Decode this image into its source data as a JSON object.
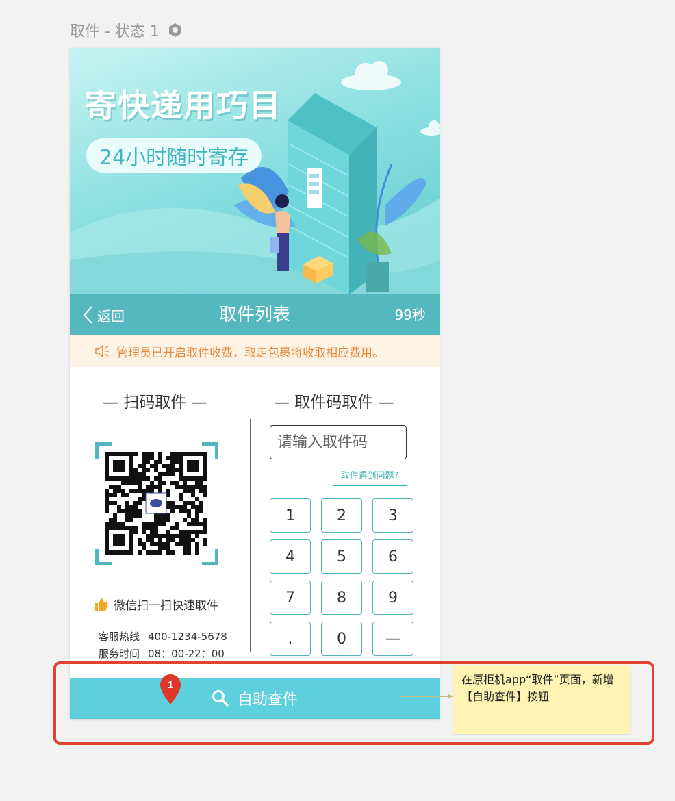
{
  "page_label": "取件 - 状态 1",
  "banner": {
    "title": "寄快递用巧目",
    "subtitle": "24小时随时寄存"
  },
  "nav": {
    "back_label": "返回",
    "title": "取件列表",
    "timer": "99秒"
  },
  "notice": "管理员已开启取件收费，取走包裹将收取相应费用。",
  "scan_section": {
    "title": "— 扫码取件 —",
    "wechat_hint": "微信扫一扫快速取件",
    "hotline_label": "客服热线",
    "hotline_value": "400-1234-5678",
    "hours_label": "服务时间",
    "hours_value": "08：00-22：00"
  },
  "code_section": {
    "title": "— 取件码取件 —",
    "placeholder": "请输入取件码",
    "help_link": "取件遇到问题?",
    "keys": [
      "1",
      "2",
      "3",
      "4",
      "5",
      "6",
      "7",
      "8",
      "9",
      ".",
      "0",
      "—"
    ]
  },
  "self_query_button": "自助查件",
  "annotation": {
    "marker_number": "1",
    "note": "在原柜机app“取件”页面，新增【自助查件】按钮"
  },
  "colors": {
    "accent": "#55b8bf",
    "button": "#5ed0dd",
    "notice_text": "#e8883a",
    "highlight": "#e0432f"
  }
}
